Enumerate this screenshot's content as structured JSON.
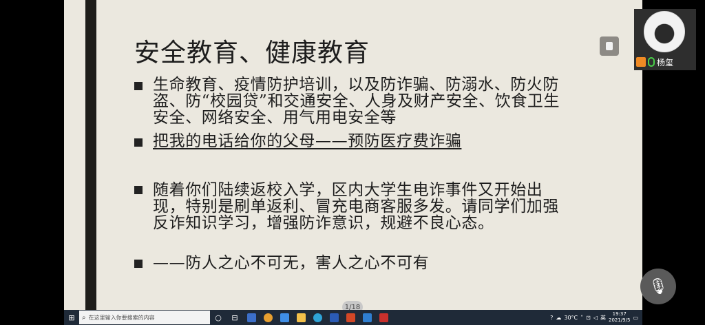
{
  "slide": {
    "title": "安全教育、健康教育",
    "bullets": [
      {
        "text": "生命教育、疫情防护培训，以及防诈骗、防溺水、防火防盗、防“校园贷”和交通安全、人身及财产安全、饮食卫生安全、网络安全、用气用电安全等"
      },
      {
        "text": "把我的电话给你的父母——预防医疗费诈骗"
      },
      {
        "text": "随着你们陆续返校入学，区内大学生电诈事件又开始出现，特别是刷单返利、冒充电商客服多发。请同学们加强反诈知识学习，增强防诈意识，规避不良心态。"
      },
      {
        "text": "——防人之心不可无，害人之心不可有"
      }
    ]
  },
  "participant": {
    "name": "杨玺"
  },
  "page_indicator": "1/18",
  "taskbar": {
    "search_placeholder": "在这里输入你要搜索的内容",
    "weather": "30°C",
    "ime": "英",
    "time": "19:37",
    "date": "2021/9/5"
  },
  "icons": {
    "start": "windows-start-icon",
    "search": "search-icon",
    "mic": "microphone-icon",
    "mute": "muted-microphone-icon"
  },
  "colors": {
    "slide_bg": "#ebe8df",
    "taskbar_bg": "#1f2a38",
    "accent_orange": "#f08a24",
    "mic_green": "#4ad14a"
  }
}
